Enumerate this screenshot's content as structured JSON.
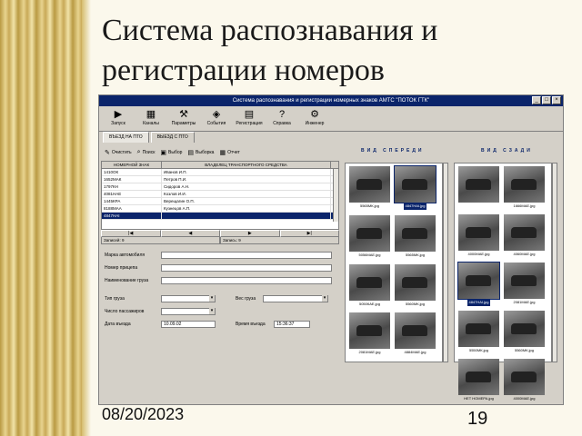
{
  "slide": {
    "title": "Система распознавания и регистрации номеров",
    "date": "08/20/2023",
    "page": "19"
  },
  "window": {
    "title": "Система распознавания и регистрации номерных знаков АМТС \"ПОТОК ГТК\"",
    "controls": [
      "_",
      "□",
      "×"
    ]
  },
  "toolbar": [
    {
      "icon": "play-icon",
      "glyph": "▶",
      "label": "Запуск"
    },
    {
      "icon": "channels-icon",
      "glyph": "▦",
      "label": "Каналы"
    },
    {
      "icon": "params-icon",
      "glyph": "⚒",
      "label": "Параметры"
    },
    {
      "icon": "events-icon",
      "glyph": "◈",
      "label": "События"
    },
    {
      "icon": "register-icon",
      "glyph": "▤",
      "label": "Регистрация"
    },
    {
      "icon": "help-icon",
      "glyph": "?",
      "label": "Справка"
    },
    {
      "icon": "engineer-icon",
      "glyph": "⚙",
      "label": "Инженер"
    }
  ],
  "tabs": [
    "ВЪЕЗД НА ПТО",
    "ВЫЕЗД С ПТО"
  ],
  "actions": [
    {
      "icon": "clear-icon",
      "glyph": "✎",
      "label": "Очистить"
    },
    {
      "icon": "search-icon",
      "glyph": "⌕",
      "label": "Поиск"
    },
    {
      "icon": "select-icon",
      "glyph": "▣",
      "label": "Выбор"
    },
    {
      "icon": "filter-icon",
      "glyph": "▤",
      "label": "Выборка"
    },
    {
      "icon": "report-icon",
      "glyph": "▦",
      "label": "Отчет"
    }
  ],
  "grid": {
    "headers": [
      "НОМЕРНОЙ ЗНАК",
      "ВЛАДЕЛЕЦ ТРАНСПОРТНОГО СРЕДСТВА"
    ],
    "rows": [
      [
        "1410ОК",
        "Иванов И.П."
      ],
      [
        "1652МАК",
        "Петров П.И."
      ],
      [
        "1797КН",
        "Сидоров А.Н."
      ],
      [
        "4081НАЕ",
        "Козлов И.И."
      ],
      [
        "1445КРА",
        "Верещагин О.П."
      ],
      [
        "8188МАА",
        "Кузнецов А.П."
      ],
      [
        "4847НАI",
        ""
      ]
    ],
    "selected_row": 6
  },
  "nav": [
    "|◀",
    "◀",
    "▶",
    "▶|"
  ],
  "status": [
    "Записей: 9",
    "Запись: 9"
  ],
  "form": {
    "make": {
      "label": "Марка автомобиля",
      "value": ""
    },
    "trailer": {
      "label": "Номер прицепа",
      "value": ""
    },
    "cargo": {
      "label": "Наименование груза",
      "value": ""
    },
    "cargo_type": {
      "label": "Тип груза",
      "value": ""
    },
    "weight": {
      "label": "Вес груза",
      "value": ""
    },
    "passengers": {
      "label": "Число пассажиров",
      "value": ""
    },
    "date": {
      "label": "Дата въезда",
      "value": "10.09.02"
    },
    "time": {
      "label": "Время въезда",
      "value": "15:36:37"
    }
  },
  "front": {
    "heading": "ВИД СПЕРЕДИ",
    "captions": [
      "5565МК.jpg",
      "4847НАI.jpg",
      "5056МАЕ.jpg",
      "5565МК.jpg",
      "5050КАЕ.jpg",
      "5560МК.jpg",
      "2081МАЕ.jpg",
      "4884МАЕ.jpg"
    ],
    "selected": 1
  },
  "rear": {
    "heading": "ВИД СЗАДИ",
    "captions": [
      "",
      "1666МАЕ.jpg",
      "4000МАЕ.jpg",
      "4060МАЕ.jpg",
      "4847НАI.jpg",
      "2081МАЕ.jpg",
      "5550МК.jpg",
      "5560МК.jpg",
      "НЕТ НОМЕРА.jpg",
      "4000МАЕ.jpg"
    ],
    "selected": 4
  }
}
